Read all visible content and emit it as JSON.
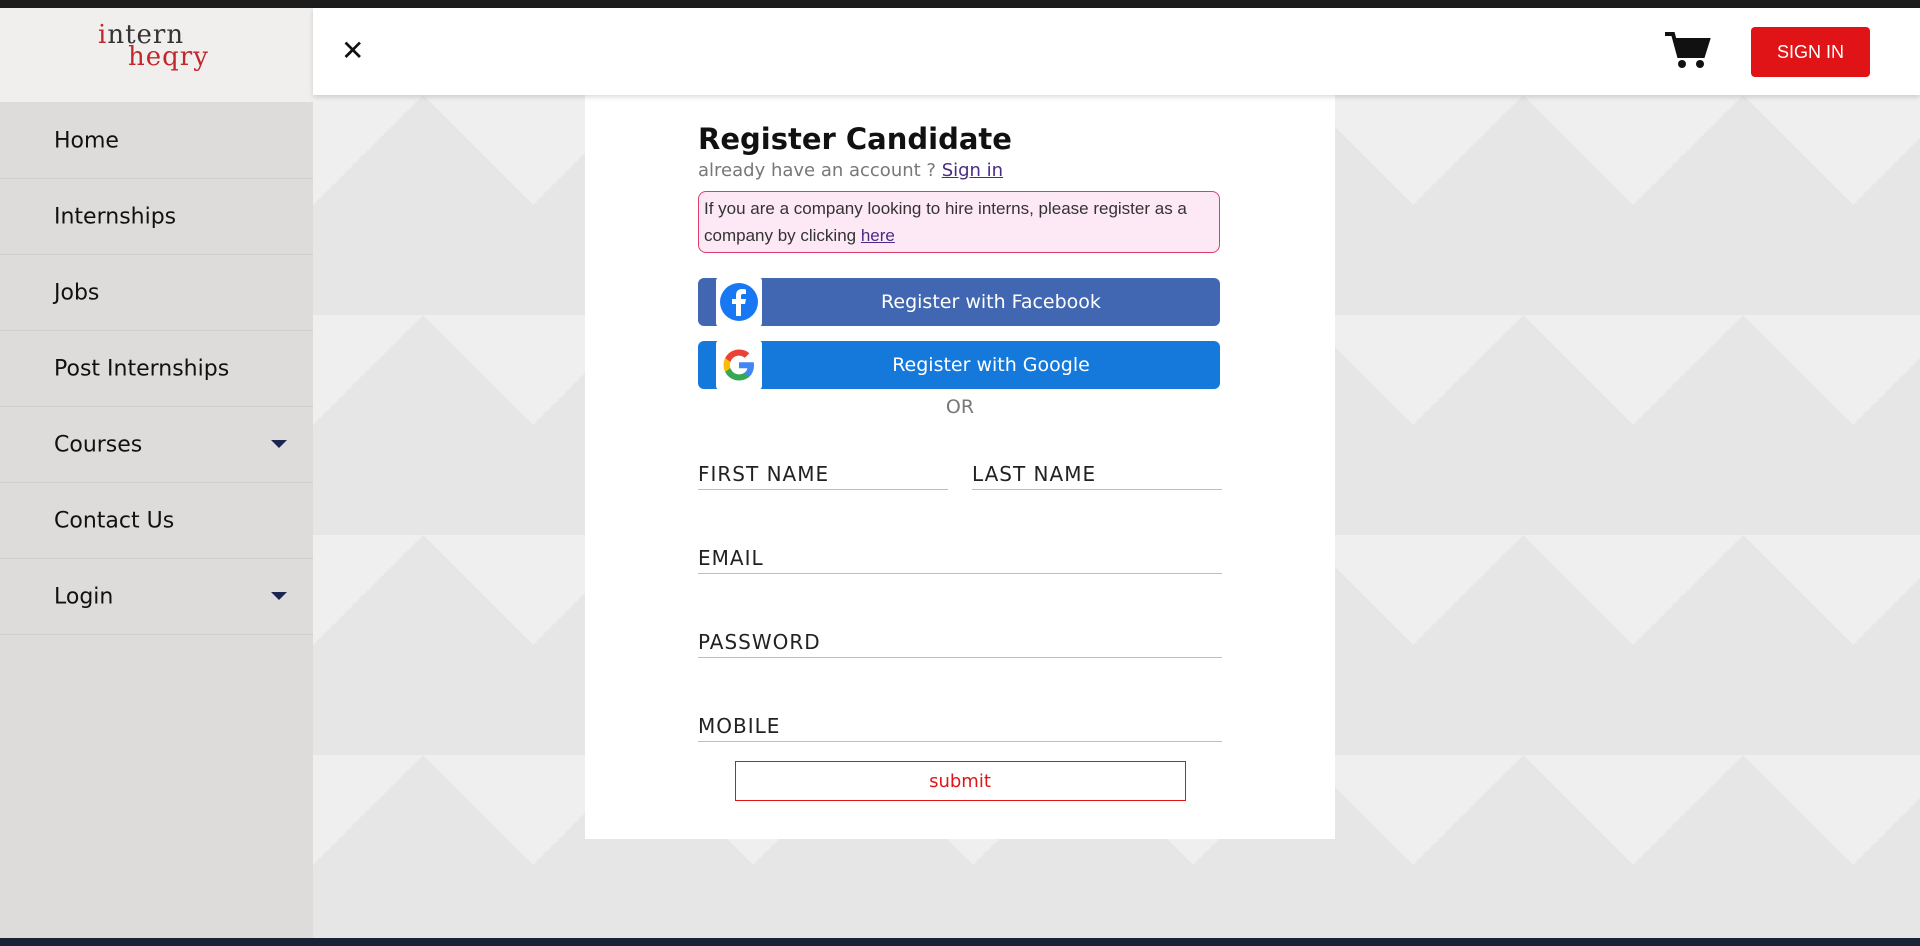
{
  "logo": {
    "line1_i": "i",
    "line1_rest": "ntern",
    "line2": "heqry"
  },
  "header": {
    "close_icon": "close-icon",
    "cart_icon": "cart-icon",
    "signin_label": "SIGN IN"
  },
  "nav": {
    "items": [
      {
        "label": "Home",
        "dropdown": false
      },
      {
        "label": "Internships",
        "dropdown": false
      },
      {
        "label": "Jobs",
        "dropdown": false
      },
      {
        "label": "Post Internships",
        "dropdown": false
      },
      {
        "label": "Courses",
        "dropdown": true
      },
      {
        "label": "Contact Us",
        "dropdown": false
      },
      {
        "label": "Login",
        "dropdown": true
      }
    ]
  },
  "form": {
    "title": "Register Candidate",
    "already_text": "already have an account ? ",
    "signin_link": "Sign in",
    "notice_text": "If you are a company looking to hire interns, please register as a company by clicking ",
    "notice_link": "here",
    "facebook_label": "Register with Facebook",
    "google_label": "Register with Google",
    "or_text": "OR",
    "first_name_placeholder": "FIRST NAME",
    "last_name_placeholder": "LAST NAME",
    "email_placeholder": "EMAIL",
    "password_placeholder": "PASSWORD",
    "mobile_placeholder": "MOBILE",
    "submit_label": "submit"
  },
  "colors": {
    "accent_red": "#e01416",
    "facebook_blue": "#4167b2",
    "google_blue": "#1479db"
  }
}
